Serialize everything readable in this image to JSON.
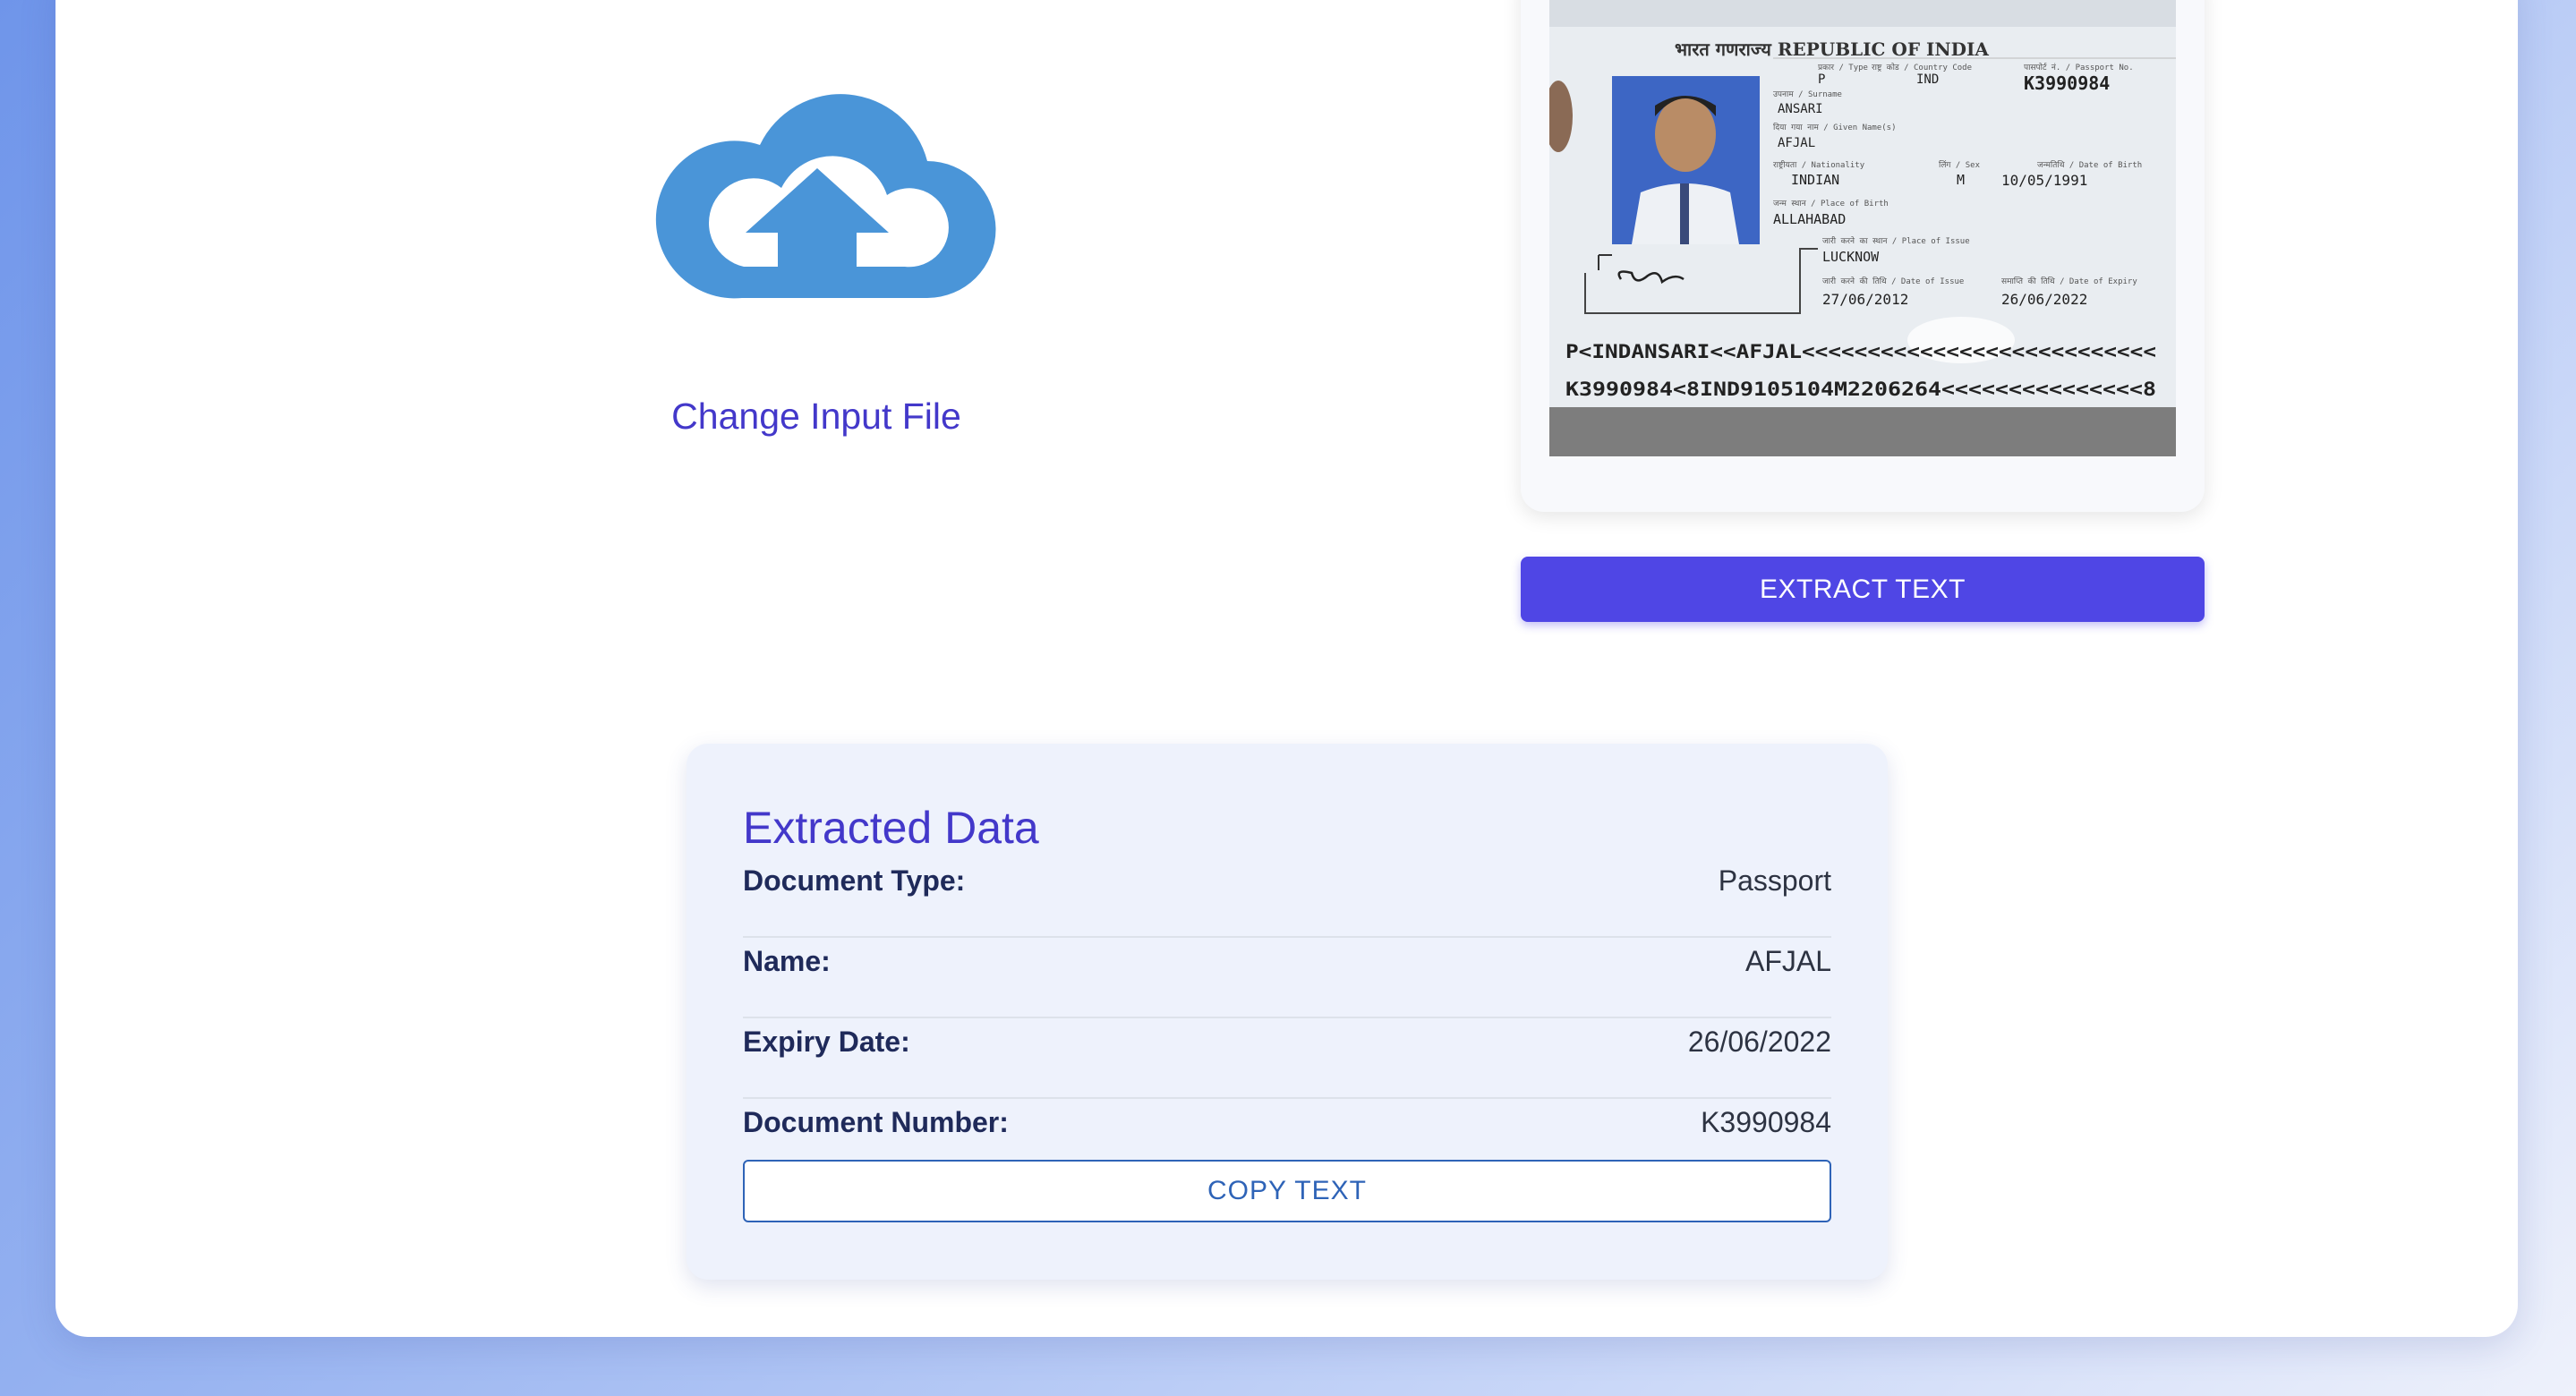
{
  "upload": {
    "change_label": "Change Input File",
    "icon": "cloud-upload-icon",
    "icon_color": "#4a95d8"
  },
  "preview": {
    "passport": {
      "header": "भारत गणराज्य  REPUBLIC OF INDIA",
      "type_label": "प्रकार / Type",
      "type": "P",
      "country_label": "राष्ट्र कोड / Country Code",
      "country": "IND",
      "passport_no_label": "पासपोर्ट नं. / Passport No.",
      "passport_no": "K3990984",
      "surname_label": "उपनाम / Surname",
      "surname": "ANSARI",
      "given_label": "दिया गया नाम / Given Name(s)",
      "given": "AFJAL",
      "nationality_label": "राष्ट्रीयता / Nationality",
      "nationality": "INDIAN",
      "sex_label": "लिंग / Sex",
      "sex": "M",
      "dob_label": "जन्मतिथि / Date of Birth",
      "dob": "10/05/1991",
      "pob_label": "जन्म स्थान / Place of Birth",
      "pob": "ALLAHABAD",
      "poi_label": "जारी करने का स्थान / Place of Issue",
      "poi": "LUCKNOW",
      "doi_label": "जारी करने की तिथि / Date of Issue",
      "doi": "27/06/2012",
      "doe_label": "समाप्ति की तिथि / Date of Expiry",
      "doe": "26/06/2022",
      "mrz1": "P<INDANSARI<<AFJAL<<<<<<<<<<<<<<<<<<<<<<<<<<<",
      "mrz2": "K3990984<8IND9105104M2206264<<<<<<<<<<<<<<<8"
    }
  },
  "extract_button": "EXTRACT TEXT",
  "extracted": {
    "title": "Extracted Data",
    "rows": [
      {
        "label": "Document Type:",
        "value": "Passport"
      },
      {
        "label": "Name:",
        "value": "AFJAL"
      },
      {
        "label": "Expiry Date:",
        "value": "26/06/2022"
      },
      {
        "label": "Document Number:",
        "value": "K3990984"
      }
    ],
    "copy_button": "COPY TEXT"
  },
  "colors": {
    "accent": "#4f46e5",
    "title": "#4338ca",
    "copy": "#2e63b7"
  }
}
